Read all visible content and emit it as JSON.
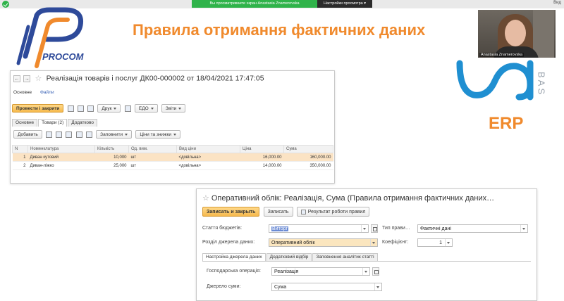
{
  "zoom": {
    "share_text": "Вы просматриваете экран Anastasia Znamerovska",
    "view_options": "Настройки просмотра",
    "right_text": "Вид"
  },
  "slide": {
    "title": "Правила отримання фактичних даних",
    "procom": "PROCOM",
    "erp": "ERP",
    "bas": "BAS",
    "accent_color": "#f08a2d",
    "brand_blue": "#2e4a9a"
  },
  "webcam": {
    "name": "Anastasia Znamerovska"
  },
  "doc": {
    "title": "Реалізація товарів і послуг ДК00-000002 от 18/04/2021 17:47:05",
    "nav_back": "←",
    "nav_forward": "→",
    "star": "☆",
    "links": [
      "Основне",
      "Файли"
    ],
    "toolbar": {
      "post_close": "Провести і закрити",
      "print": "Друк",
      "edo": "ЕДО",
      "reports": "Звіти"
    },
    "tabs": [
      "Основне",
      "Товари (2)",
      "Додатково"
    ],
    "subbar": {
      "add": "Добавить",
      "fill": "Заповнити",
      "prices": "Ціни та знижки"
    },
    "table": {
      "headers": [
        "N",
        "Номенклатура",
        "Кількість",
        "Од. вим.",
        "Вид ціни",
        "Ціна",
        "Сума"
      ],
      "rows": [
        [
          "1",
          "Диван кутовий",
          "10,000",
          "шт",
          "<довільна>",
          "16,000.00",
          "160,000.00"
        ],
        [
          "2",
          "Диван-ліжко",
          "25,000",
          "шт",
          "<довільна>",
          "14,000.00",
          "350,000.00"
        ]
      ]
    }
  },
  "rule": {
    "star": "☆",
    "title": "Оперативний облік: Реалізація, Сума (Правила отримання фактичних даних…",
    "save_close": "Записать и закрыть",
    "save": "Записать",
    "results": "Результат роботи правил",
    "budget_item_label": "Стаття бюджетів:",
    "budget_item_value": "Виторг",
    "rule_type_label": "Тип прави…",
    "rule_type_value": "Фактичні дані",
    "source_section_label": "Розділ джерела даних:",
    "source_section_value": "Оперативний облік",
    "coef_label": "Коефіцієнт:",
    "coef_value": "1",
    "tabs": [
      "Настройка джерела даних",
      "Додатковий відбір",
      "Заповнення аналітик статті"
    ],
    "operation_label": "Господарська операція:",
    "operation_value": "Реалізація",
    "sum_source_label": "Джерело суми:",
    "sum_source_value": "Сума"
  }
}
